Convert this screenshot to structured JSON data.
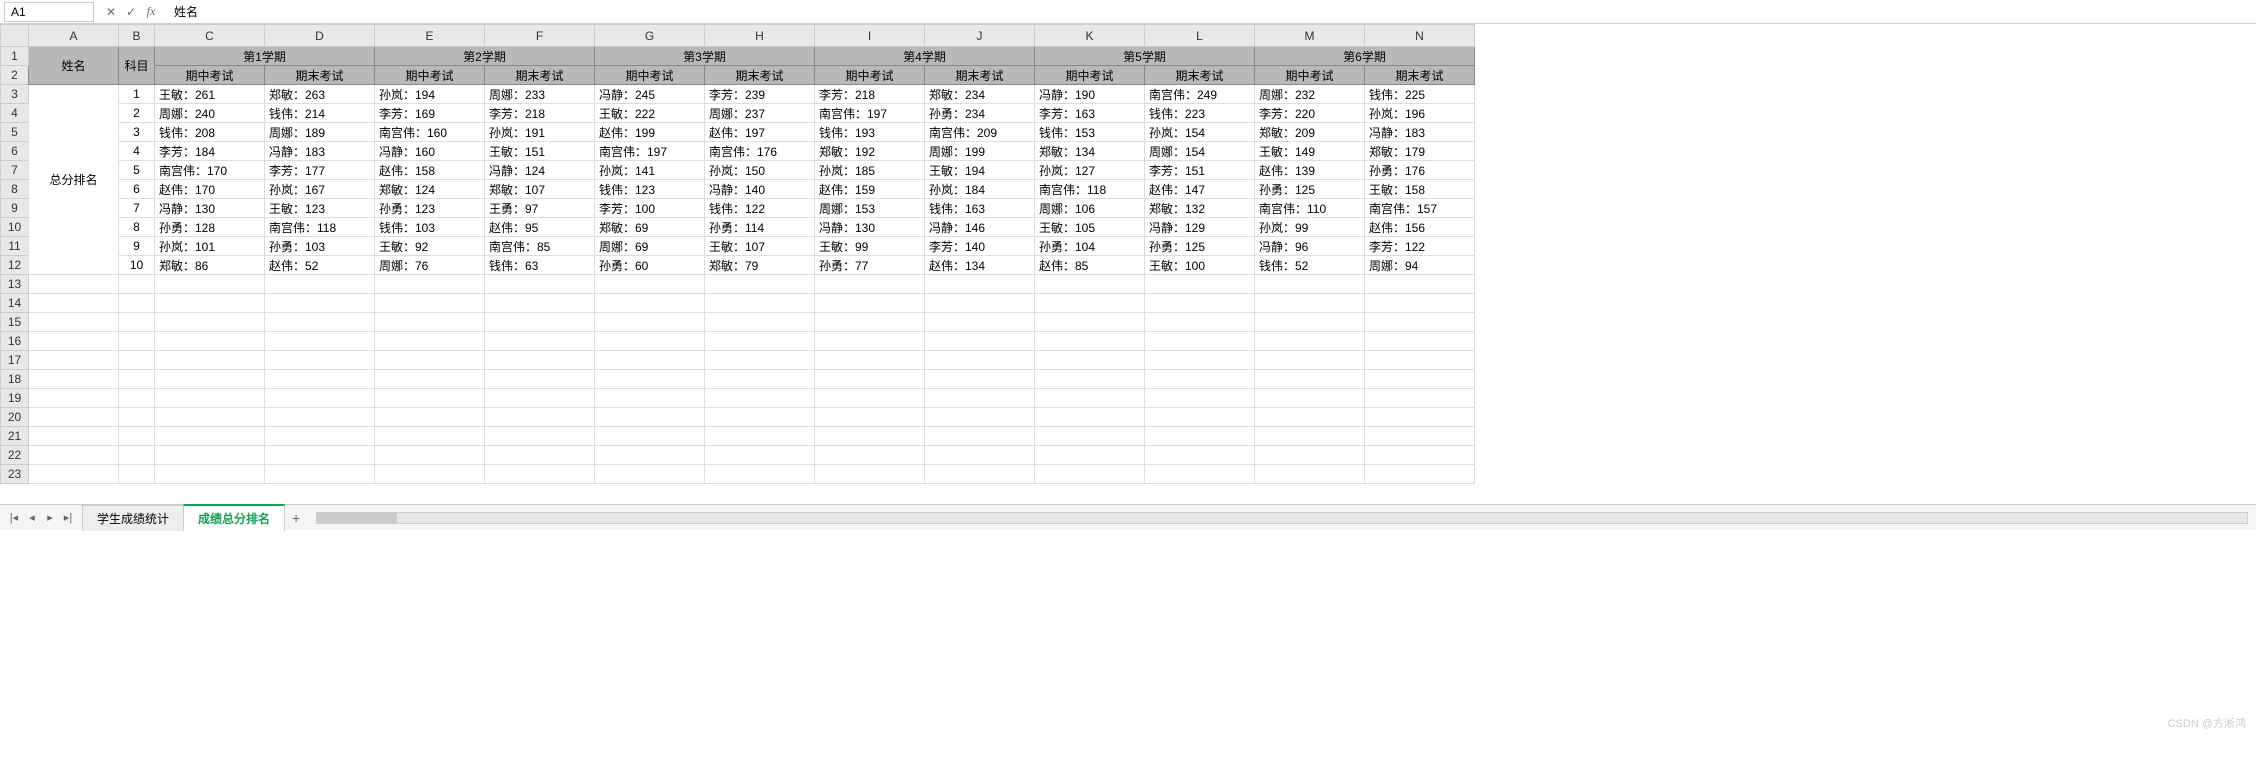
{
  "cellRef": "A1",
  "formulaValue": "姓名",
  "columns": [
    "A",
    "B",
    "C",
    "D",
    "E",
    "F",
    "G",
    "H",
    "I",
    "J",
    "K",
    "L",
    "M",
    "N"
  ],
  "rowCount": 23,
  "header": {
    "nameLabel": "姓名",
    "subjectLabel": "科目",
    "semesters": [
      "第1学期",
      "第2学期",
      "第3学期",
      "第4学期",
      "第5学期",
      "第6学期"
    ],
    "exams": [
      "期中考试",
      "期末考试"
    ]
  },
  "rowLabel": "总分排名",
  "ranks": [
    1,
    2,
    3,
    4,
    5,
    6,
    7,
    8,
    9,
    10
  ],
  "grid": [
    [
      "王敏：261",
      "郑敏：263",
      "孙岚：194",
      "周娜：233",
      "冯静：245",
      "李芳：239",
      "李芳：218",
      "郑敏：234",
      "冯静：190",
      "南宫伟：249",
      "周娜：232",
      "钱伟：225"
    ],
    [
      "周娜：240",
      "钱伟：214",
      "李芳：169",
      "李芳：218",
      "王敏：222",
      "周娜：237",
      "南宫伟：197",
      "孙勇：234",
      "李芳：163",
      "钱伟：223",
      "李芳：220",
      "孙岚：196"
    ],
    [
      "钱伟：208",
      "周娜：189",
      "南宫伟：160",
      "孙岚：191",
      "赵伟：199",
      "赵伟：197",
      "钱伟：193",
      "南宫伟：209",
      "钱伟：153",
      "孙岚：154",
      "郑敏：209",
      "冯静：183"
    ],
    [
      "李芳：184",
      "冯静：183",
      "冯静：160",
      "王敏：151",
      "南宫伟：197",
      "南宫伟：176",
      "郑敏：192",
      "周娜：199",
      "郑敏：134",
      "周娜：154",
      "王敏：149",
      "郑敏：179"
    ],
    [
      "南宫伟：170",
      "李芳：177",
      "赵伟：158",
      "冯静：124",
      "孙岚：141",
      "孙岚：150",
      "孙岚：185",
      "王敏：194",
      "孙岚：127",
      "李芳：151",
      "赵伟：139",
      "孙勇：176"
    ],
    [
      "赵伟：170",
      "孙岚：167",
      "郑敏：124",
      "郑敏：107",
      "钱伟：123",
      "冯静：140",
      "赵伟：159",
      "孙岚：184",
      "南宫伟：118",
      "赵伟：147",
      "孙勇：125",
      "王敏：158"
    ],
    [
      "冯静：130",
      "王敏：123",
      "孙勇：123",
      "王勇：97",
      "李芳：100",
      "钱伟：122",
      "周娜：153",
      "钱伟：163",
      "周娜：106",
      "郑敏：132",
      "南宫伟：110",
      "南宫伟：157"
    ],
    [
      "孙勇：128",
      "南宫伟：118",
      "钱伟：103",
      "赵伟：95",
      "郑敏：69",
      "孙勇：114",
      "冯静：130",
      "冯静：146",
      "王敏：105",
      "冯静：129",
      "孙岚：99",
      "赵伟：156"
    ],
    [
      "孙岚：101",
      "孙勇：103",
      "王敏：92",
      "南宫伟：85",
      "周娜：69",
      "王敏：107",
      "王敏：99",
      "李芳：140",
      "孙勇：104",
      "孙勇：125",
      "冯静：96",
      "李芳：122"
    ],
    [
      "郑敏：86",
      "赵伟：52",
      "周娜：76",
      "钱伟：63",
      "孙勇：60",
      "郑敏：79",
      "孙勇：77",
      "赵伟：134",
      "赵伟：85",
      "王敏：100",
      "钱伟：52",
      "周娜：94"
    ]
  ],
  "tabs": {
    "tab1": "学生成绩统计",
    "tab2": "成绩总分排名"
  },
  "watermark": "CSDN @方淅鸿"
}
